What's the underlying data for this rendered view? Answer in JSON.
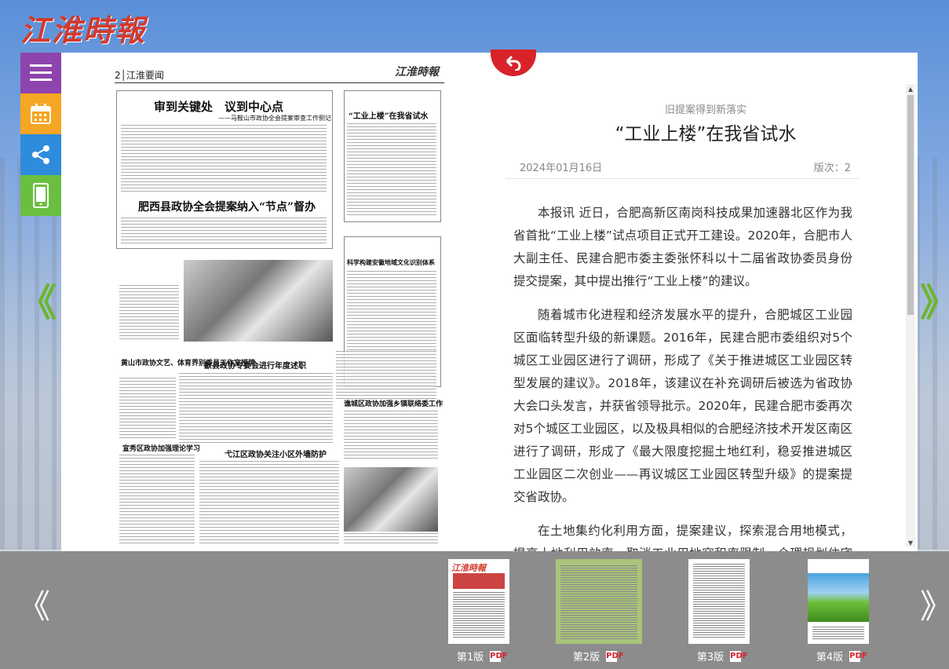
{
  "logo": "江淮時報",
  "sidebar": {
    "buttons": [
      "menu",
      "calendar",
      "share",
      "mobile"
    ]
  },
  "nav": {
    "prev_page": "《",
    "next_page": "》"
  },
  "newspaper": {
    "page_header": "2│江淮要闻",
    "masthead_small": "江淮時報",
    "headlines": {
      "h1": "审到关键处　议到中心点",
      "h1_sub": "——马鞍山市政协全会提案审查工作侧记",
      "h2": "肥西县政协全会提案纳入“节点”督办",
      "h3": "“工业上楼”在我省试水",
      "h4": "科学构建安徽地域文化识别体系",
      "h5": "黄山市政协文艺、体育界别委员工作室授牌",
      "h6": "歙县政协专委会进行年度述职",
      "h7": "宣秀区政协加强理论学习",
      "h8": "弋江区政协关注小区外墙防护",
      "h9": "谯城区政协加强乡镇联络委工作"
    }
  },
  "article": {
    "subtitle": "旧提案得到新落实",
    "title": "“工业上楼”在我省试水",
    "date": "2024年01月16日",
    "edition": "版次：2",
    "paragraphs": [
      "本报讯 近日，合肥高新区南岗科技成果加速器北区作为我省首批“工业上楼”试点项目正式开工建设。2020年，合肥市人大副主任、民建合肥市委主委张怀科以十二届省政协委员身份提交提案，其中提出推行“工业上楼”的建议。",
      "随着城市化进程和经济发展水平的提升，合肥城区工业园区面临转型升级的新课题。2016年，民建合肥市委组织对5个城区工业园区进行了调研，形成了《关于推进城区工业园区转型发展的建议》。2018年，该建议在补充调研后被选为省政协大会口头发言，并获省领导批示。2020年，民建合肥市委再次对5个城区工业园区，以及极具相似的合肥经济技术开发区南区进行了调研，形成了《最大限度挖掘土地红利，稳妥推进城区工业园区二次创业——再议城区工业园区转型升级》的提案提交省政协。",
      "在土地集约化利用方面，提案建议，探索混合用地模式，提高土地利用效率。取消工业用地容积率限制，合理规划住宅用地，抑制“房地产冲动”，鼓励园区产权单位通过改建、拆建等"
    ]
  },
  "pages": [
    {
      "label": "第1版",
      "pdf": "PDF"
    },
    {
      "label": "第2版",
      "pdf": "PDF"
    },
    {
      "label": "第3版",
      "pdf": "PDF"
    },
    {
      "label": "第4版",
      "pdf": "PDF"
    }
  ],
  "colors": {
    "accent_red": "#d8232a",
    "arrow_green": "#6cb52d",
    "menu_purple": "#8e44ad",
    "calendar_orange": "#f5a623",
    "share_blue": "#2d8cdb",
    "phone_green": "#6abf40"
  }
}
